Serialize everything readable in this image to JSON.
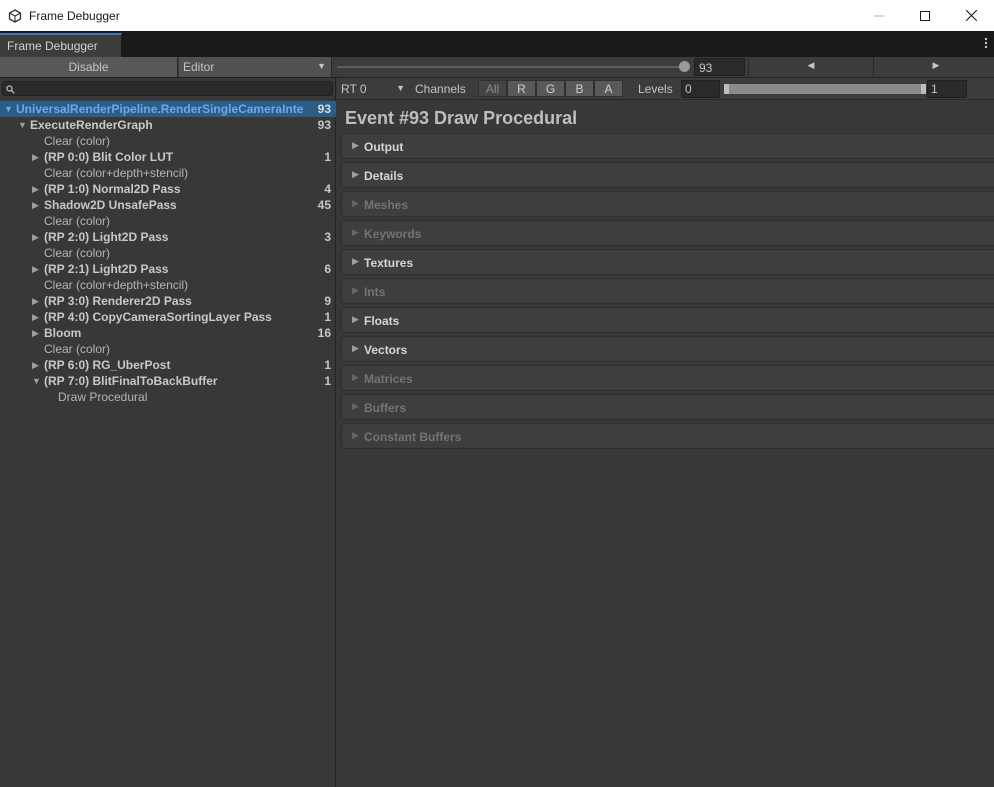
{
  "window": {
    "title": "Frame Debugger"
  },
  "tab": {
    "label": "Frame Debugger"
  },
  "toolbar": {
    "disable_label": "Disable",
    "target_dropdown": "Editor",
    "event_index": "93",
    "event_slider_fraction": 1.0
  },
  "tree": {
    "search_value": "",
    "rows": [
      {
        "label": "UniversalRenderPipeline.RenderSingleCameraInte",
        "count": "93",
        "arrow": "▼",
        "level": 0,
        "style": "selected"
      },
      {
        "label": "ExecuteRenderGraph",
        "count": "93",
        "arrow": "▼",
        "level": 1,
        "style": "bold"
      },
      {
        "label": "Clear (color)",
        "count": "",
        "arrow": "",
        "level": 2,
        "style": "plain"
      },
      {
        "label": "(RP 0:0) Blit Color LUT",
        "count": "1",
        "arrow": "▶",
        "level": 2,
        "style": "bold"
      },
      {
        "label": "Clear (color+depth+stencil)",
        "count": "",
        "arrow": "",
        "level": 2,
        "style": "plain"
      },
      {
        "label": "(RP 1:0) Normal2D Pass",
        "count": "4",
        "arrow": "▶",
        "level": 2,
        "style": "bold"
      },
      {
        "label": "Shadow2D UnsafePass",
        "count": "45",
        "arrow": "▶",
        "level": 2,
        "style": "bold"
      },
      {
        "label": "Clear (color)",
        "count": "",
        "arrow": "",
        "level": 2,
        "style": "plain"
      },
      {
        "label": "(RP 2:0) Light2D Pass",
        "count": "3",
        "arrow": "▶",
        "level": 2,
        "style": "bold"
      },
      {
        "label": "Clear (color)",
        "count": "",
        "arrow": "",
        "level": 2,
        "style": "plain"
      },
      {
        "label": "(RP 2:1) Light2D Pass",
        "count": "6",
        "arrow": "▶",
        "level": 2,
        "style": "bold"
      },
      {
        "label": "Clear (color+depth+stencil)",
        "count": "",
        "arrow": "",
        "level": 2,
        "style": "plain"
      },
      {
        "label": "(RP 3:0) Renderer2D Pass",
        "count": "9",
        "arrow": "▶",
        "level": 2,
        "style": "bold"
      },
      {
        "label": "(RP 4:0) CopyCameraSortingLayer Pass",
        "count": "1",
        "arrow": "▶",
        "level": 2,
        "style": "bold"
      },
      {
        "label": "Bloom",
        "count": "16",
        "arrow": "▶",
        "level": 2,
        "style": "bold"
      },
      {
        "label": "Clear (color)",
        "count": "",
        "arrow": "",
        "level": 2,
        "style": "plain"
      },
      {
        "label": "(RP 6:0) RG_UberPost",
        "count": "1",
        "arrow": "▶",
        "level": 2,
        "style": "bold"
      },
      {
        "label": "(RP 7:0) BlitFinalToBackBuffer",
        "count": "1",
        "arrow": "▼",
        "level": 2,
        "style": "bold"
      },
      {
        "label": "Draw Procedural",
        "count": "",
        "arrow": "",
        "level": 3,
        "style": "plain"
      }
    ]
  },
  "render_target": {
    "rt_dropdown": "RT 0",
    "channels_label": "Channels",
    "channels": [
      "All",
      "R",
      "G",
      "B",
      "A"
    ],
    "levels_label": "Levels",
    "level_min": "0",
    "level_max": "1"
  },
  "event": {
    "title": "Event #93 Draw Procedural",
    "sections": [
      {
        "label": "Output",
        "enabled": true
      },
      {
        "label": "Details",
        "enabled": true
      },
      {
        "label": "Meshes",
        "enabled": false
      },
      {
        "label": "Keywords",
        "enabled": false
      },
      {
        "label": "Textures",
        "enabled": true
      },
      {
        "label": "Ints",
        "enabled": false
      },
      {
        "label": "Floats",
        "enabled": true
      },
      {
        "label": "Vectors",
        "enabled": true
      },
      {
        "label": "Matrices",
        "enabled": false
      },
      {
        "label": "Buffers",
        "enabled": false
      },
      {
        "label": "Constant Buffers",
        "enabled": false
      }
    ]
  },
  "icons": {
    "app": "unity-cube-icon",
    "minimize": "minimize-icon",
    "maximize": "maximize-icon",
    "close": "close-icon",
    "menu": "kebab-menu-icon",
    "search": "search-icon",
    "prev": "prev-event-icon",
    "next": "next-event-icon"
  }
}
